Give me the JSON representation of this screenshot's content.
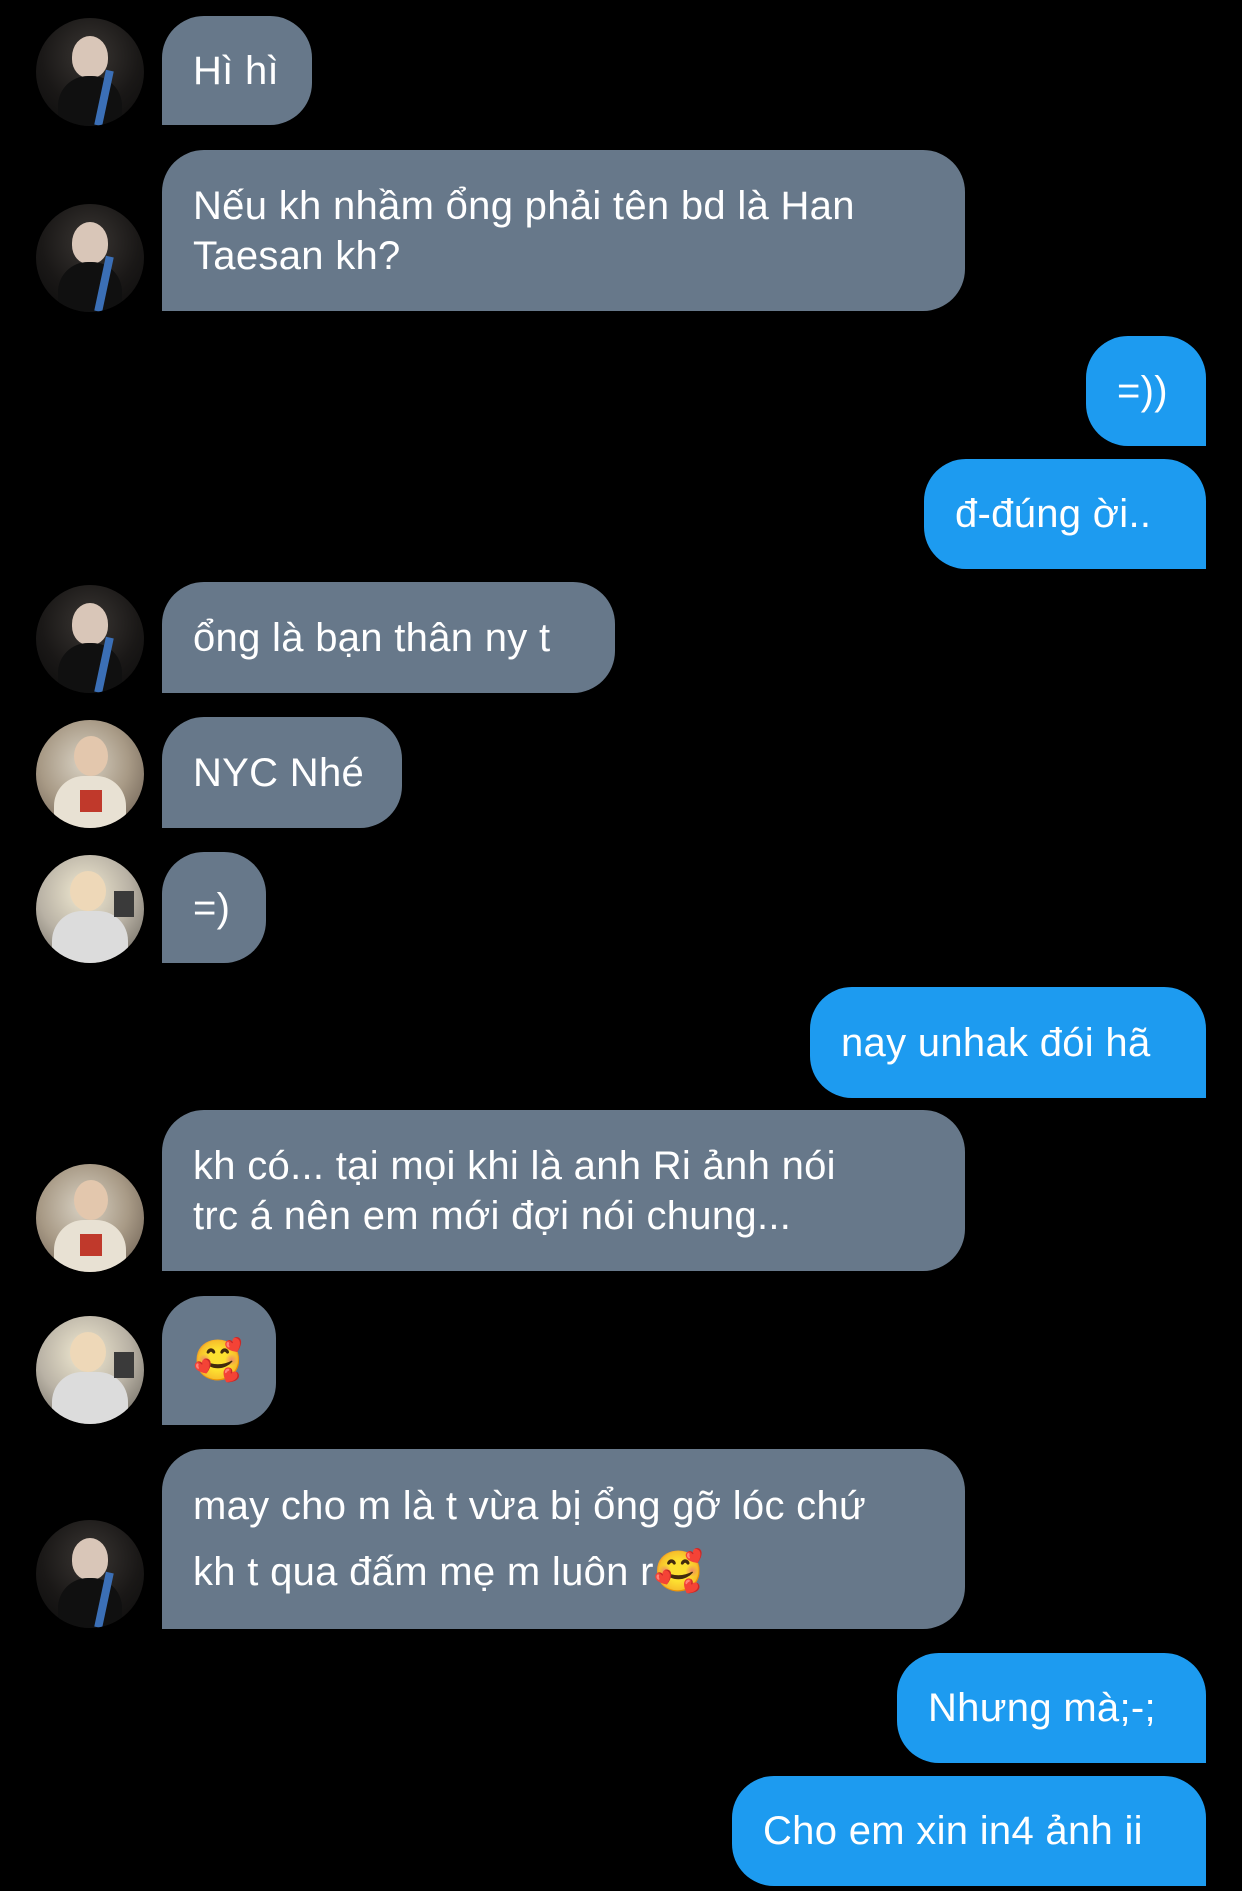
{
  "conversation": {
    "messages": [
      {
        "text": "Hì hì"
      },
      {
        "text": "Nếu kh nhầm ổng phải tên bd là Han\nTaesan kh?"
      },
      {
        "text": "=))"
      },
      {
        "text": "đ-đúng ời.."
      },
      {
        "text": "ổng là bạn thân ny t"
      },
      {
        "text": "NYC Nhé"
      },
      {
        "text": "=)"
      },
      {
        "text": "nay unhak đói hã"
      },
      {
        "text": "kh có... tại mọi khi là anh Ri ảnh nói\ntrc á nên em mới đợi nói chung..."
      },
      {
        "text": "🥰"
      },
      {
        "text": "may cho m là t vừa bị ổng gỡ lóc chứ\nkh t qua đấm mẹ m luôn r🥰"
      },
      {
        "text": "Nhưng mà;-;"
      },
      {
        "text": "Cho em xin in4 ảnh ii"
      }
    ]
  },
  "colors": {
    "background": "#000000",
    "incoming_bubble": "#67788a",
    "outgoing_bubble": "#1d9bf0",
    "text": "#ffffff"
  }
}
